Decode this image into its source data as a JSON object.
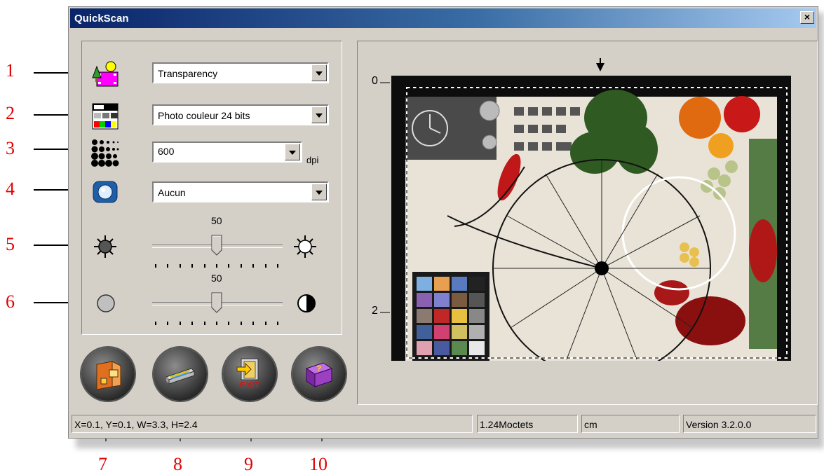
{
  "window": {
    "title": "QuickScan",
    "close_label": "×"
  },
  "controls": {
    "scan_type": {
      "value": "Transparency",
      "icon": "scan-type-icon"
    },
    "color_mode": {
      "value": "Photo couleur 24 bits",
      "icon": "color-mode-icon"
    },
    "resolution": {
      "value": "600",
      "unit": "dpi",
      "icon": "resolution-icon"
    },
    "filter": {
      "value": "Aucun",
      "icon": "filter-icon"
    },
    "brightness": {
      "value": "50",
      "level": 0.5,
      "icon": "brightness-icon"
    },
    "contrast": {
      "value": "50",
      "level": 0.5,
      "icon": "contrast-icon"
    }
  },
  "buttons": [
    {
      "icon": "scan-to-file-icon"
    },
    {
      "icon": "scanner-preview-icon"
    },
    {
      "icon": "exit-icon",
      "text": "EXIT"
    },
    {
      "icon": "help-book-icon",
      "text": "?"
    }
  ],
  "preview": {
    "ruler_top": "0",
    "ruler_mid": "2"
  },
  "status": {
    "coords": "X=0.1, Y=0.1, W=3.3, H=2.4",
    "size": "1.24Moctets",
    "unit": "cm",
    "version": "Version 3.2.0.0"
  },
  "annotations": {
    "left": [
      "1",
      "2",
      "3",
      "4",
      "5",
      "6"
    ],
    "bottom": [
      "7",
      "8",
      "9",
      "10"
    ]
  },
  "colors": {
    "annotation": "#e00000",
    "title_bar": "#0a246a"
  }
}
